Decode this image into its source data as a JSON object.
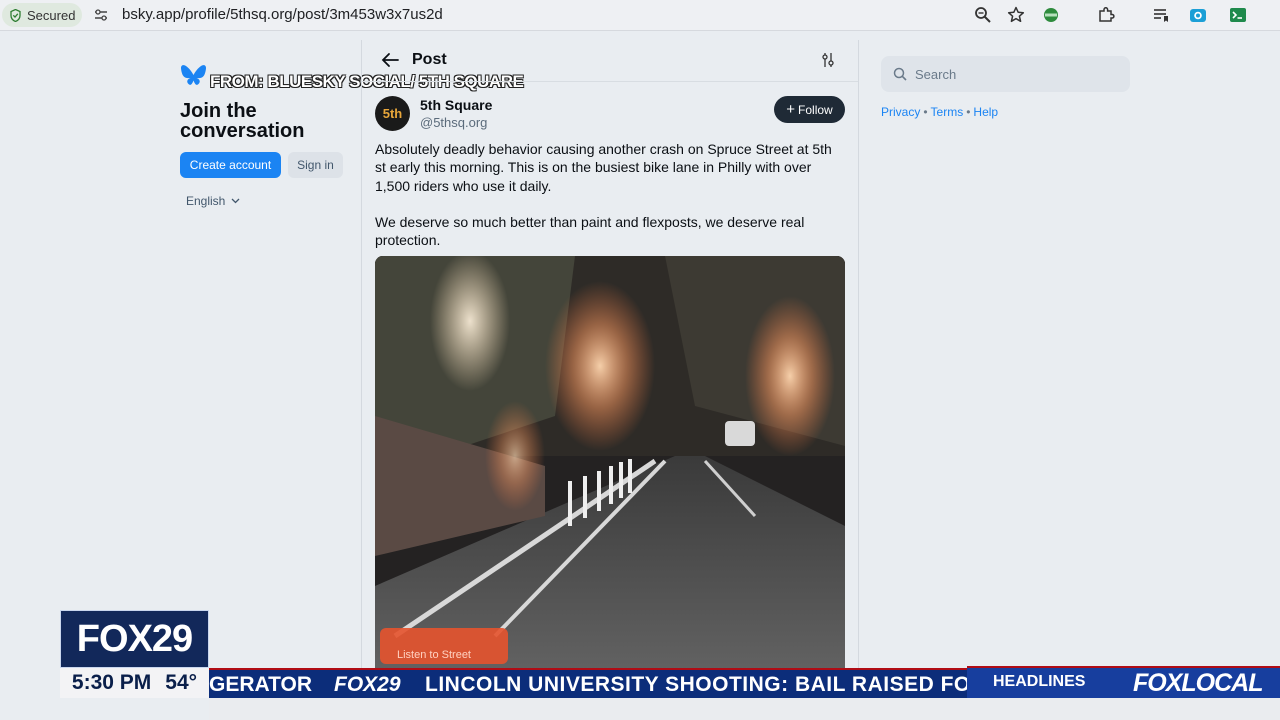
{
  "browser": {
    "secure_label": "Secured",
    "url": "bsky.app/profile/5thsq.org/post/3m453w3x7us2d"
  },
  "left": {
    "overlay_source": "FROM: BLUESKY SOCIAL/ 5TH SQUARE",
    "join_title": "Join the conversation",
    "create_account": "Create account",
    "sign_in": "Sign in",
    "language": "English"
  },
  "post": {
    "header_title": "Post",
    "author_name": "5th Square",
    "author_handle": "@5thsq.org",
    "avatar_text": "5th",
    "follow_label": "Follow",
    "paragraph_1": "Absolutely deadly behavior causing another crash on Spruce Street at 5th st early this morning. This is on the busiest bike lane in Philly with over 1,500 riders who use it daily.",
    "paragraph_2": "We deserve so much better than paint and flexposts, we deserve real protection.",
    "video_caption": "Listen to Street"
  },
  "right": {
    "search_placeholder": "Search",
    "links": [
      "Privacy",
      "Terms",
      "Help"
    ]
  },
  "tv": {
    "station_logo": "FOX29",
    "time": "5:30 PM",
    "temperature": "54°",
    "ticker_prev": "GERATOR",
    "ticker_logo": "FOX29",
    "ticker_text": "LINCOLN UNIVERSITY SHOOTING: BAIL RAISED FOR",
    "headlines": "HEADLINES",
    "brand": "FOXLOCAL"
  },
  "colors": {
    "accent_blue": "#1b84f3",
    "ticker_blue": "#0c2d7a",
    "ticker_red": "#b00c15"
  }
}
